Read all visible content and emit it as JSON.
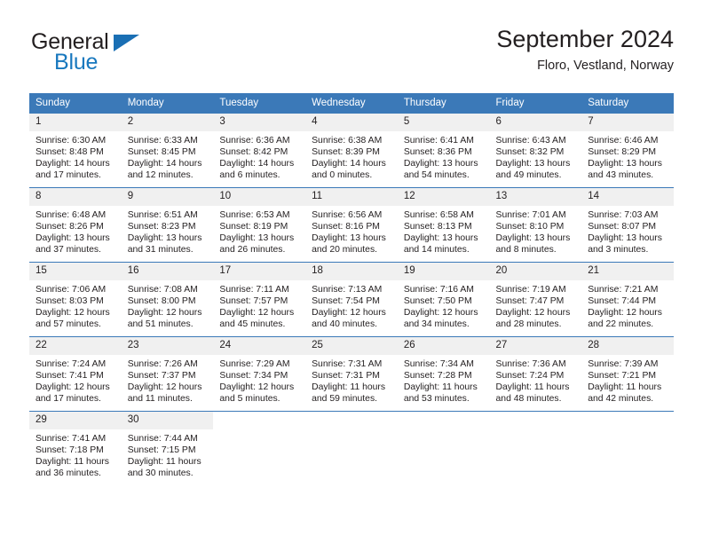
{
  "brand": {
    "name_top": "General",
    "name_bottom": "Blue",
    "triangle_icon": "triangle-icon",
    "color_dark": "#231f20",
    "color_blue": "#1878be"
  },
  "header": {
    "title": "September 2024",
    "subtitle": "Floro, Vestland, Norway"
  },
  "theme": {
    "header_bg": "#3b79b8",
    "header_text": "#ffffff",
    "daynum_bg": "#f0f0f0",
    "cell_border": "#3b79b8",
    "body_text": "#231f20"
  },
  "calendar": {
    "weekday_headers": [
      "Sunday",
      "Monday",
      "Tuesday",
      "Wednesday",
      "Thursday",
      "Friday",
      "Saturday"
    ],
    "weeks": [
      [
        {
          "day": "1",
          "sunrise": "Sunrise: 6:30 AM",
          "sunset": "Sunset: 8:48 PM",
          "daylight_line1": "Daylight: 14 hours",
          "daylight_line2": "and 17 minutes."
        },
        {
          "day": "2",
          "sunrise": "Sunrise: 6:33 AM",
          "sunset": "Sunset: 8:45 PM",
          "daylight_line1": "Daylight: 14 hours",
          "daylight_line2": "and 12 minutes."
        },
        {
          "day": "3",
          "sunrise": "Sunrise: 6:36 AM",
          "sunset": "Sunset: 8:42 PM",
          "daylight_line1": "Daylight: 14 hours",
          "daylight_line2": "and 6 minutes."
        },
        {
          "day": "4",
          "sunrise": "Sunrise: 6:38 AM",
          "sunset": "Sunset: 8:39 PM",
          "daylight_line1": "Daylight: 14 hours",
          "daylight_line2": "and 0 minutes."
        },
        {
          "day": "5",
          "sunrise": "Sunrise: 6:41 AM",
          "sunset": "Sunset: 8:36 PM",
          "daylight_line1": "Daylight: 13 hours",
          "daylight_line2": "and 54 minutes."
        },
        {
          "day": "6",
          "sunrise": "Sunrise: 6:43 AM",
          "sunset": "Sunset: 8:32 PM",
          "daylight_line1": "Daylight: 13 hours",
          "daylight_line2": "and 49 minutes."
        },
        {
          "day": "7",
          "sunrise": "Sunrise: 6:46 AM",
          "sunset": "Sunset: 8:29 PM",
          "daylight_line1": "Daylight: 13 hours",
          "daylight_line2": "and 43 minutes."
        }
      ],
      [
        {
          "day": "8",
          "sunrise": "Sunrise: 6:48 AM",
          "sunset": "Sunset: 8:26 PM",
          "daylight_line1": "Daylight: 13 hours",
          "daylight_line2": "and 37 minutes."
        },
        {
          "day": "9",
          "sunrise": "Sunrise: 6:51 AM",
          "sunset": "Sunset: 8:23 PM",
          "daylight_line1": "Daylight: 13 hours",
          "daylight_line2": "and 31 minutes."
        },
        {
          "day": "10",
          "sunrise": "Sunrise: 6:53 AM",
          "sunset": "Sunset: 8:19 PM",
          "daylight_line1": "Daylight: 13 hours",
          "daylight_line2": "and 26 minutes."
        },
        {
          "day": "11",
          "sunrise": "Sunrise: 6:56 AM",
          "sunset": "Sunset: 8:16 PM",
          "daylight_line1": "Daylight: 13 hours",
          "daylight_line2": "and 20 minutes."
        },
        {
          "day": "12",
          "sunrise": "Sunrise: 6:58 AM",
          "sunset": "Sunset: 8:13 PM",
          "daylight_line1": "Daylight: 13 hours",
          "daylight_line2": "and 14 minutes."
        },
        {
          "day": "13",
          "sunrise": "Sunrise: 7:01 AM",
          "sunset": "Sunset: 8:10 PM",
          "daylight_line1": "Daylight: 13 hours",
          "daylight_line2": "and 8 minutes."
        },
        {
          "day": "14",
          "sunrise": "Sunrise: 7:03 AM",
          "sunset": "Sunset: 8:07 PM",
          "daylight_line1": "Daylight: 13 hours",
          "daylight_line2": "and 3 minutes."
        }
      ],
      [
        {
          "day": "15",
          "sunrise": "Sunrise: 7:06 AM",
          "sunset": "Sunset: 8:03 PM",
          "daylight_line1": "Daylight: 12 hours",
          "daylight_line2": "and 57 minutes."
        },
        {
          "day": "16",
          "sunrise": "Sunrise: 7:08 AM",
          "sunset": "Sunset: 8:00 PM",
          "daylight_line1": "Daylight: 12 hours",
          "daylight_line2": "and 51 minutes."
        },
        {
          "day": "17",
          "sunrise": "Sunrise: 7:11 AM",
          "sunset": "Sunset: 7:57 PM",
          "daylight_line1": "Daylight: 12 hours",
          "daylight_line2": "and 45 minutes."
        },
        {
          "day": "18",
          "sunrise": "Sunrise: 7:13 AM",
          "sunset": "Sunset: 7:54 PM",
          "daylight_line1": "Daylight: 12 hours",
          "daylight_line2": "and 40 minutes."
        },
        {
          "day": "19",
          "sunrise": "Sunrise: 7:16 AM",
          "sunset": "Sunset: 7:50 PM",
          "daylight_line1": "Daylight: 12 hours",
          "daylight_line2": "and 34 minutes."
        },
        {
          "day": "20",
          "sunrise": "Sunrise: 7:19 AM",
          "sunset": "Sunset: 7:47 PM",
          "daylight_line1": "Daylight: 12 hours",
          "daylight_line2": "and 28 minutes."
        },
        {
          "day": "21",
          "sunrise": "Sunrise: 7:21 AM",
          "sunset": "Sunset: 7:44 PM",
          "daylight_line1": "Daylight: 12 hours",
          "daylight_line2": "and 22 minutes."
        }
      ],
      [
        {
          "day": "22",
          "sunrise": "Sunrise: 7:24 AM",
          "sunset": "Sunset: 7:41 PM",
          "daylight_line1": "Daylight: 12 hours",
          "daylight_line2": "and 17 minutes."
        },
        {
          "day": "23",
          "sunrise": "Sunrise: 7:26 AM",
          "sunset": "Sunset: 7:37 PM",
          "daylight_line1": "Daylight: 12 hours",
          "daylight_line2": "and 11 minutes."
        },
        {
          "day": "24",
          "sunrise": "Sunrise: 7:29 AM",
          "sunset": "Sunset: 7:34 PM",
          "daylight_line1": "Daylight: 12 hours",
          "daylight_line2": "and 5 minutes."
        },
        {
          "day": "25",
          "sunrise": "Sunrise: 7:31 AM",
          "sunset": "Sunset: 7:31 PM",
          "daylight_line1": "Daylight: 11 hours",
          "daylight_line2": "and 59 minutes."
        },
        {
          "day": "26",
          "sunrise": "Sunrise: 7:34 AM",
          "sunset": "Sunset: 7:28 PM",
          "daylight_line1": "Daylight: 11 hours",
          "daylight_line2": "and 53 minutes."
        },
        {
          "day": "27",
          "sunrise": "Sunrise: 7:36 AM",
          "sunset": "Sunset: 7:24 PM",
          "daylight_line1": "Daylight: 11 hours",
          "daylight_line2": "and 48 minutes."
        },
        {
          "day": "28",
          "sunrise": "Sunrise: 7:39 AM",
          "sunset": "Sunset: 7:21 PM",
          "daylight_line1": "Daylight: 11 hours",
          "daylight_line2": "and 42 minutes."
        }
      ],
      [
        {
          "day": "29",
          "sunrise": "Sunrise: 7:41 AM",
          "sunset": "Sunset: 7:18 PM",
          "daylight_line1": "Daylight: 11 hours",
          "daylight_line2": "and 36 minutes."
        },
        {
          "day": "30",
          "sunrise": "Sunrise: 7:44 AM",
          "sunset": "Sunset: 7:15 PM",
          "daylight_line1": "Daylight: 11 hours",
          "daylight_line2": "and 30 minutes."
        },
        null,
        null,
        null,
        null,
        null
      ]
    ]
  }
}
